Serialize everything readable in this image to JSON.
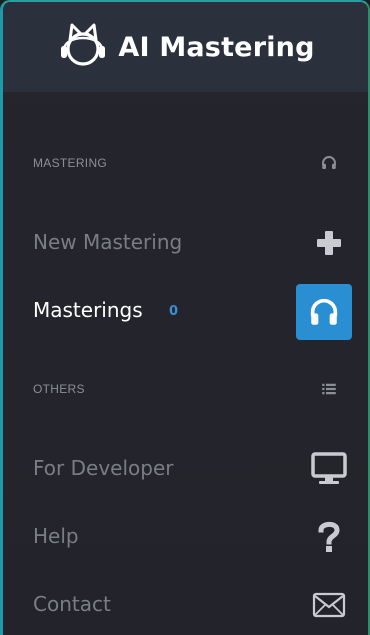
{
  "header": {
    "title": "AI Mastering",
    "logo_icon": "cat-headphones-logo-icon"
  },
  "sections": [
    {
      "label": "MASTERING",
      "icon": "headphones-icon",
      "items": [
        {
          "label": "New Mastering",
          "icon": "plus-icon",
          "active": false
        },
        {
          "label": "Masterings",
          "badge": "0",
          "icon": "headphones-icon",
          "active": true
        }
      ]
    },
    {
      "label": "OTHERS",
      "icon": "list-icon",
      "items": [
        {
          "label": "For Developer",
          "icon": "monitor-icon",
          "active": false
        },
        {
          "label": "Help",
          "icon": "question-icon",
          "active": false
        },
        {
          "label": "Contact",
          "icon": "envelope-icon",
          "active": false
        }
      ]
    }
  ],
  "colors": {
    "header_bg": "#2b313c",
    "panel_bg": "#23242b",
    "active_button_bg": "#2a8fd2",
    "badge": "#3a8fd0",
    "muted_text": "#7b7d85",
    "active_text": "#ffffff",
    "border_accent": "#1f9aa8"
  }
}
